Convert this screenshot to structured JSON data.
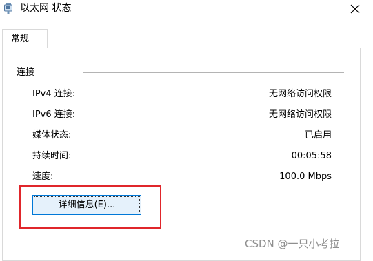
{
  "window": {
    "title": "以太网 状态",
    "icon": "network-adapter-icon",
    "close_icon": "close-icon"
  },
  "tabs": [
    {
      "label": "常规",
      "selected": true
    }
  ],
  "connection": {
    "section_label": "连接",
    "rows": [
      {
        "label": "IPv4 连接:",
        "value": "无网络访问权限"
      },
      {
        "label": "IPv6 连接:",
        "value": "无网络访问权限"
      },
      {
        "label": "媒体状态:",
        "value": "已启用"
      },
      {
        "label": "持续时间:",
        "value": "00:05:58"
      },
      {
        "label": "速度:",
        "value": "100.0 Mbps"
      }
    ],
    "details_button": "详细信息(E)..."
  },
  "annotation": {
    "highlight_color": "#e0262b"
  },
  "watermark": "CSDN @一只小考拉"
}
